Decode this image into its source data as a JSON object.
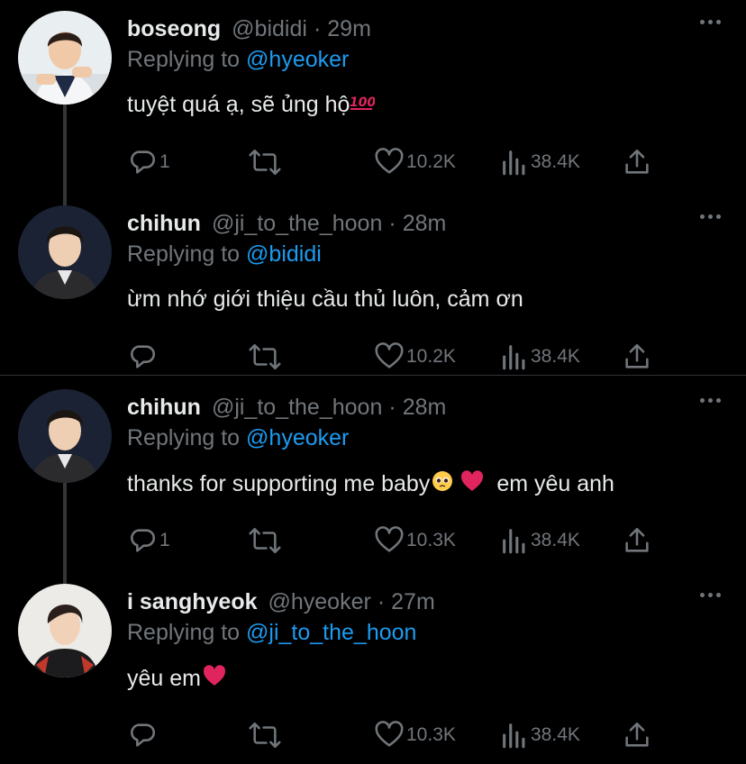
{
  "tweets": [
    {
      "name": "boseong",
      "handle": "@bididi",
      "separator": "·",
      "time": "29m",
      "replying_prefix": "Replying to",
      "replying_handle": "@hyeoker",
      "text": "tuyệt quá ạ, sẽ ủng hộ",
      "text_emoji": "💯",
      "text_after": "",
      "replies": "1",
      "likes": "10.2K",
      "views": "38.4K"
    },
    {
      "name": "chihun",
      "handle": "@ji_to_the_hoon",
      "separator": "·",
      "time": "28m",
      "replying_prefix": "Replying to",
      "replying_handle": "@bididi",
      "text": "ừm nhớ giới thiệu cầu thủ luôn, cảm ơn",
      "text_emoji": "",
      "text_after": "",
      "replies": "",
      "likes": "10.2K",
      "views": "38.4K"
    },
    {
      "name": "chihun",
      "handle": "@ji_to_the_hoon",
      "separator": "·",
      "time": "28m",
      "replying_prefix": "Replying to",
      "replying_handle": "@hyeoker",
      "text": "thanks for supporting me baby",
      "text_emoji": "🥺 ❤️",
      "text_after": "em yêu anh",
      "replies": "1",
      "likes": "10.3K",
      "views": "38.4K"
    },
    {
      "name": "i sanghyeok",
      "handle": "@hyeoker",
      "separator": "·",
      "time": "27m",
      "replying_prefix": "Replying to",
      "replying_handle": "@ji_to_the_hoon",
      "text": "yêu em",
      "text_emoji": "❤️",
      "text_after": "",
      "replies": "",
      "likes": "10.3K",
      "views": "38.4K"
    }
  ],
  "icons": {
    "reply": "reply-icon",
    "retweet": "retweet-icon",
    "like": "heart-icon",
    "views": "views-icon",
    "share": "share-icon",
    "more": "more-icon"
  },
  "colors": {
    "background": "#000000",
    "text": "#e7e9ea",
    "muted": "#71767b",
    "link": "#1d9bf0",
    "heart_emoji": "#e0245e"
  }
}
